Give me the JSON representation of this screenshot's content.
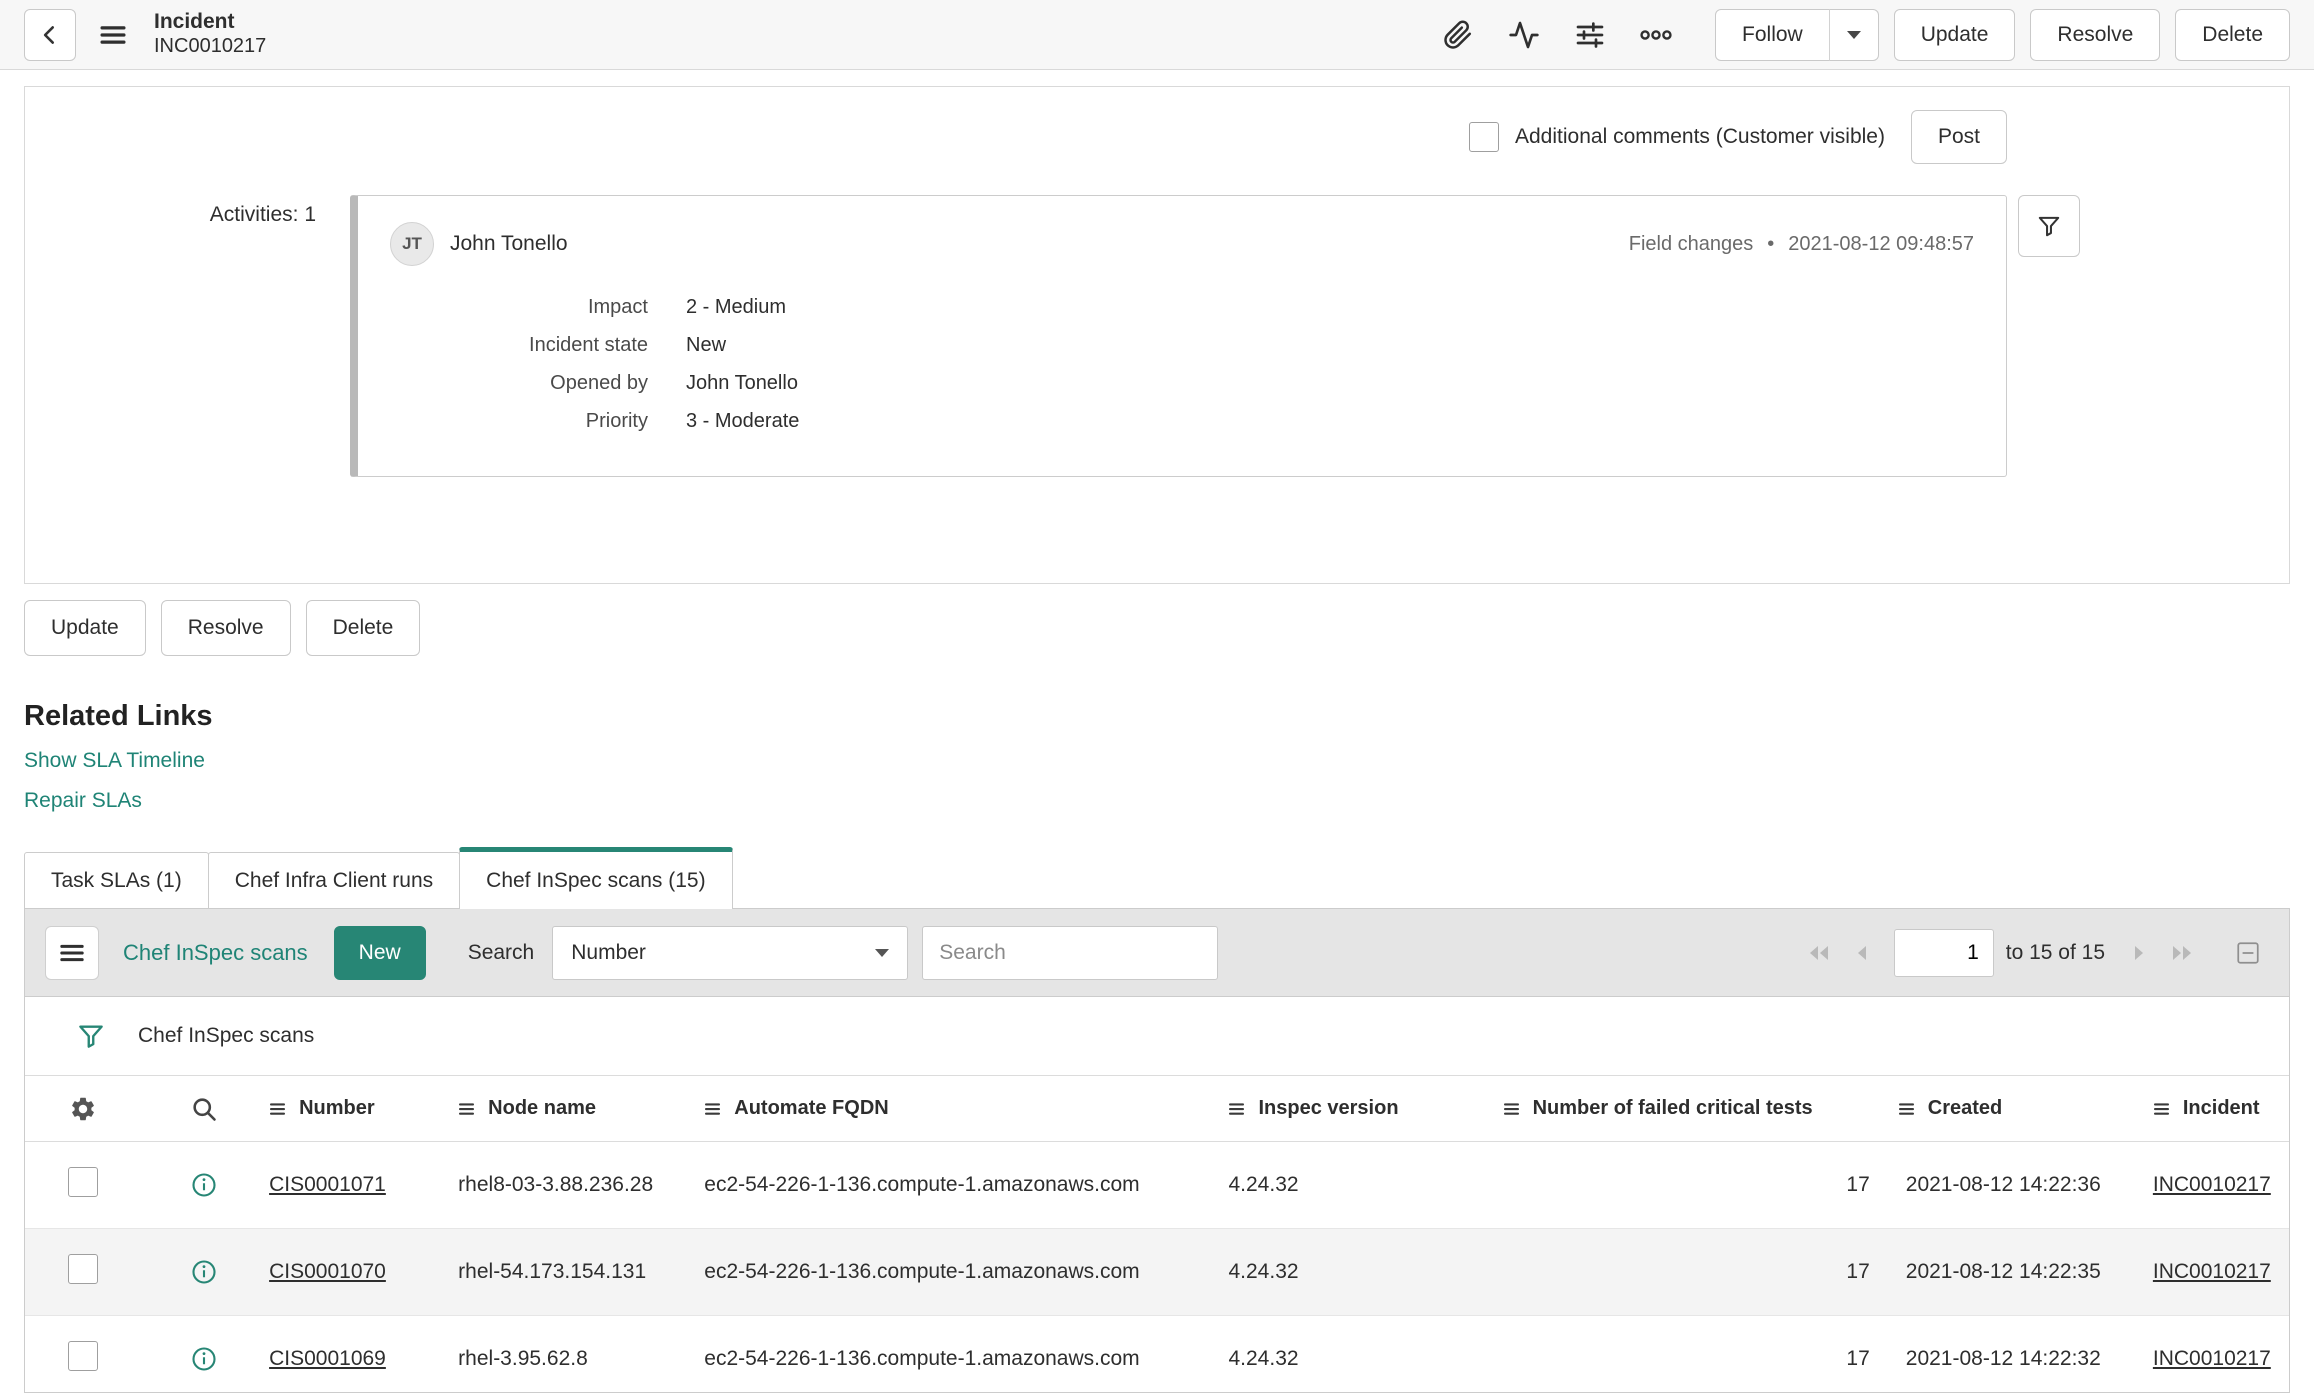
{
  "header": {
    "title_line1": "Incident",
    "title_line2": "INC0010217",
    "actions": {
      "follow": "Follow",
      "update": "Update",
      "resolve": "Resolve",
      "delete": "Delete"
    }
  },
  "comments": {
    "checkbox_label": "Additional comments (Customer visible)",
    "post": "Post"
  },
  "activities": {
    "count_label": "Activities: 1",
    "entry": {
      "avatar_initials": "JT",
      "author": "John Tonello",
      "event_type": "Field changes",
      "separator": "•",
      "timestamp": "2021-08-12 09:48:57",
      "fields": [
        {
          "label": "Impact",
          "value": "2 - Medium"
        },
        {
          "label": "Incident state",
          "value": "New"
        },
        {
          "label": "Opened by",
          "value": "John Tonello"
        },
        {
          "label": "Priority",
          "value": "3 - Moderate"
        }
      ]
    }
  },
  "form_actions": {
    "update": "Update",
    "resolve": "Resolve",
    "delete": "Delete"
  },
  "related_links": {
    "title": "Related Links",
    "links": [
      {
        "label": "Show SLA Timeline"
      },
      {
        "label": "Repair SLAs"
      }
    ]
  },
  "tabs": [
    {
      "label": "Task SLAs (1)",
      "active": false
    },
    {
      "label": "Chef Infra Client runs",
      "active": false
    },
    {
      "label": "Chef InSpec scans (15)",
      "active": true
    }
  ],
  "list": {
    "title": "Chef InSpec scans",
    "new_button": "New",
    "search_label": "Search",
    "search_field": "Number",
    "search_placeholder": "Search",
    "pagination": {
      "page": "1",
      "range": "to 15 of 15"
    },
    "breadcrumb": "Chef InSpec scans",
    "columns": [
      "Number",
      "Node name",
      "Automate FQDN",
      "Inspec version",
      "Number of failed critical tests",
      "Created",
      "Incident"
    ],
    "rows": [
      {
        "number": "CIS0001071",
        "node_name": "rhel8-03-3.88.236.28",
        "automate_fqdn": "ec2-54-226-1-136.compute-1.amazonaws.com",
        "inspec_version": "4.24.32",
        "failed_critical_tests": "17",
        "created": "2021-08-12 14:22:36",
        "incident": "INC0010217"
      },
      {
        "number": "CIS0001070",
        "node_name": "rhel-54.173.154.131",
        "automate_fqdn": "ec2-54-226-1-136.compute-1.amazonaws.com",
        "inspec_version": "4.24.32",
        "failed_critical_tests": "17",
        "created": "2021-08-12 14:22:35",
        "incident": "INC0010217"
      },
      {
        "number": "CIS0001069",
        "node_name": "rhel-3.95.62.8",
        "automate_fqdn": "ec2-54-226-1-136.compute-1.amazonaws.com",
        "inspec_version": "4.24.32",
        "failed_critical_tests": "17",
        "created": "2021-08-12 14:22:32",
        "incident": "INC0010217"
      }
    ]
  },
  "colors": {
    "accent_teal": "#278675",
    "link_teal": "#1f8476",
    "row_alt": "#f4f4f4"
  }
}
